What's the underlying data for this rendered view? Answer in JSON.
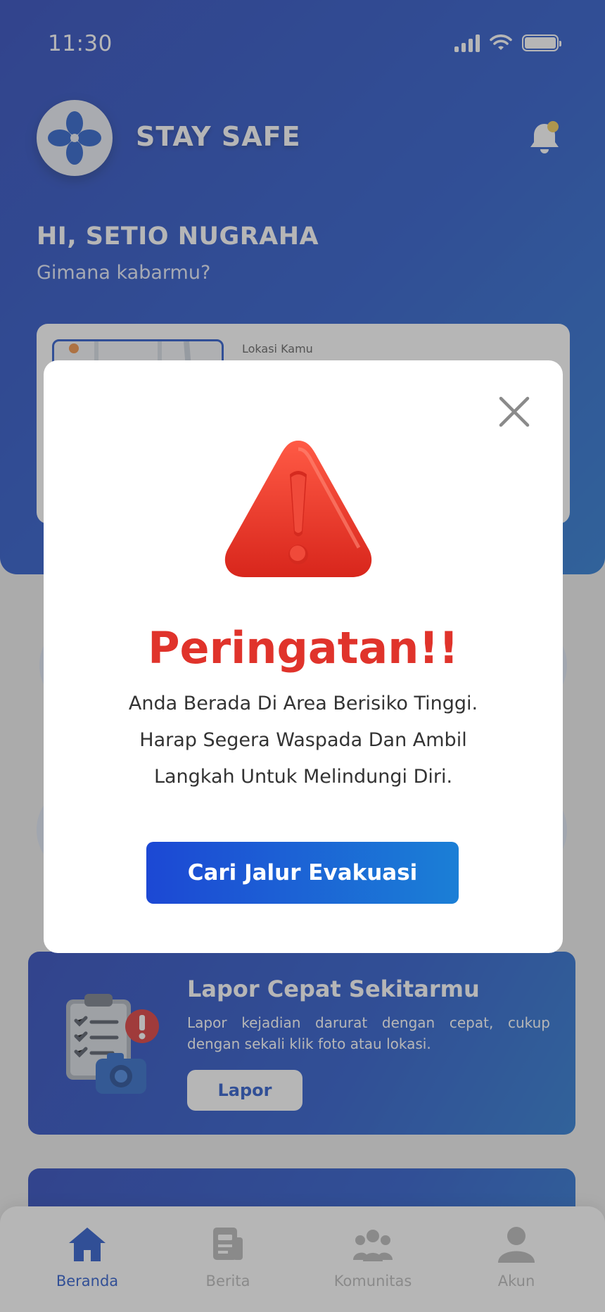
{
  "status": {
    "time": "11:30"
  },
  "header": {
    "app_title": "STAY SAFE",
    "greeting": "HI, SETIO NUGRAHA",
    "subtitle": "Gimana kabarmu?"
  },
  "location_card": {
    "label": "Lokasi Kamu"
  },
  "report_card": {
    "title": "Lapor Cepat Sekitarmu",
    "description": "Lapor kejadian darurat dengan cepat, cukup dengan sekali klik  foto atau lokasi.",
    "button_label": "Lapor"
  },
  "modal": {
    "title": "Peringatan!!",
    "message_line1": "Anda Berada Di Area Berisiko Tinggi.",
    "message_line2": "Harap Segera Waspada Dan Ambil",
    "message_line3": "Langkah Untuk Melindungi Diri.",
    "button_label": "Cari Jalur Evakuasi"
  },
  "bottom_nav": {
    "items": [
      {
        "label": "Beranda",
        "icon": "home-icon",
        "active": true
      },
      {
        "label": "Berita",
        "icon": "news-icon",
        "active": false
      },
      {
        "label": "Komunitas",
        "icon": "community-icon",
        "active": false
      },
      {
        "label": "Akun",
        "icon": "user-icon",
        "active": false
      }
    ]
  },
  "colors": {
    "primary": "#1a4ec8",
    "warning": "#e0332b",
    "accent_dot": "#f2c94c"
  }
}
